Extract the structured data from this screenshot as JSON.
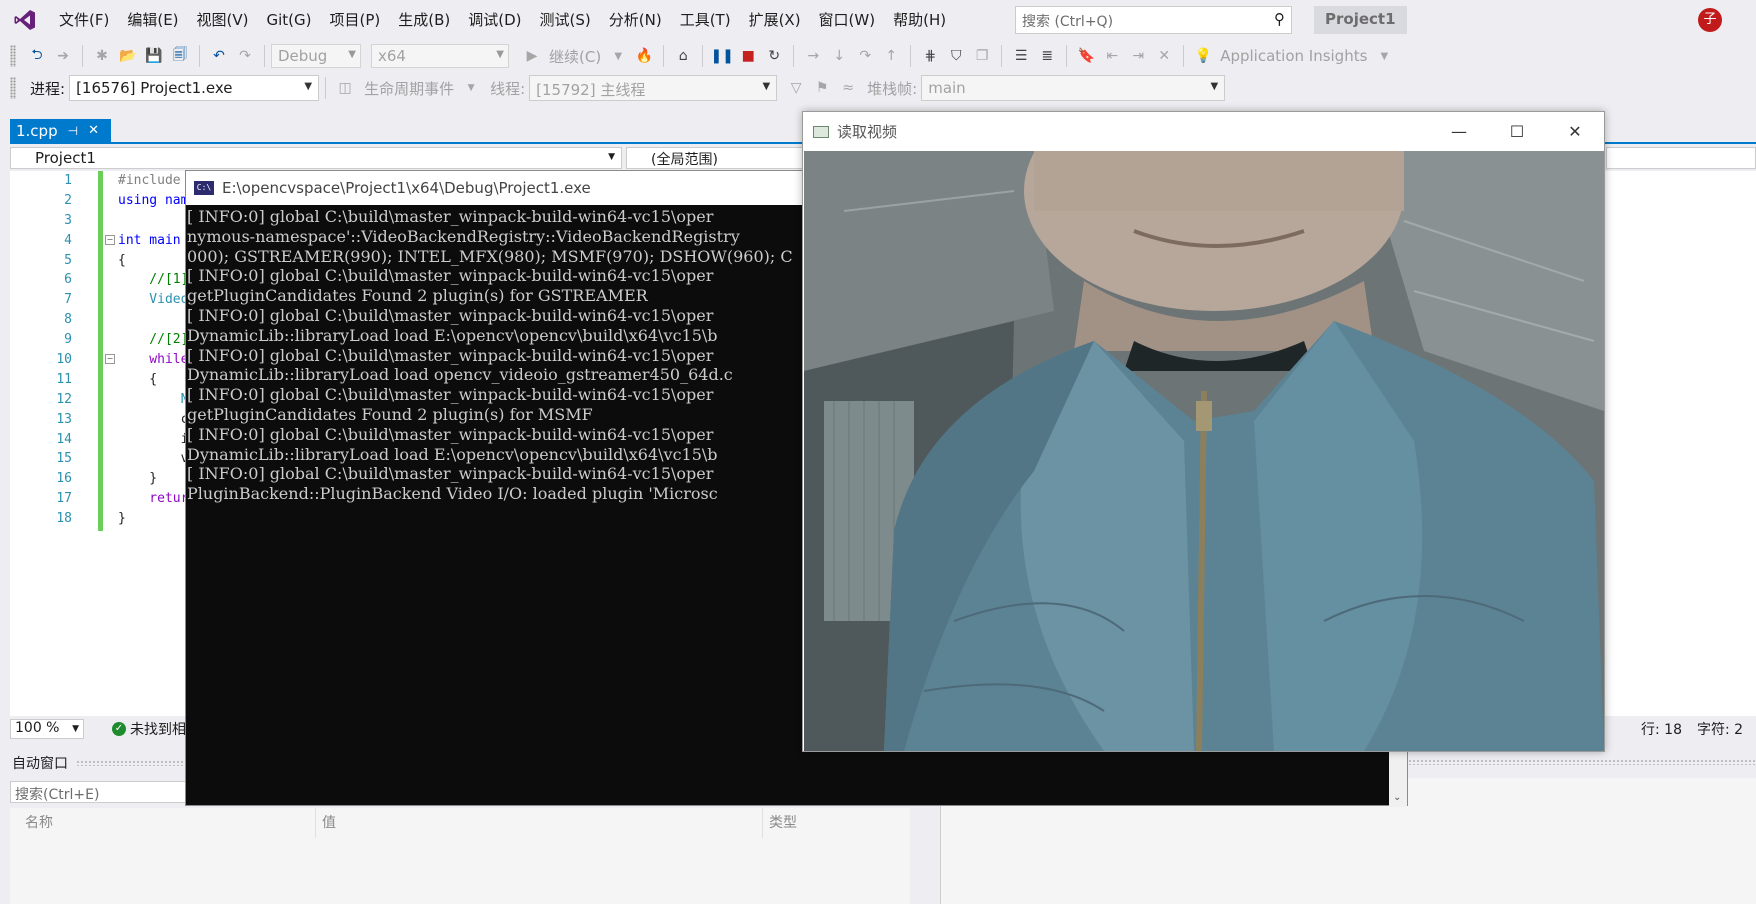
{
  "menubar": {
    "items": [
      "文件(F)",
      "编辑(E)",
      "视图(V)",
      "Git(G)",
      "项目(P)",
      "生成(B)",
      "调试(D)",
      "测试(S)",
      "分析(N)",
      "工具(T)",
      "扩展(X)",
      "窗口(W)",
      "帮助(H)"
    ],
    "search_placeholder": "搜索 (Ctrl+Q)",
    "project_badge": "Project1",
    "avatar_initial": "子"
  },
  "toolbar1": {
    "config": "Debug",
    "platform": "x64",
    "continue_label": "继续(C)",
    "app_insights": "Application Insights"
  },
  "toolbar2": {
    "process_label": "进程:",
    "process_value": "[16576] Project1.exe",
    "lifecycle_label": "生命周期事件",
    "thread_label": "线程:",
    "thread_value": "[15792] 主线程",
    "stackframe_label": "堆栈帧:",
    "stackframe_value": "main"
  },
  "editor": {
    "tab_label": "1.cpp",
    "nav_project": "Project1",
    "nav_scope": "(全局范围)",
    "line_numbers": [
      "1",
      "2",
      "3",
      "4",
      "5",
      "6",
      "7",
      "8",
      "9",
      "10",
      "11",
      "12",
      "13",
      "14",
      "15",
      "16",
      "17",
      "18"
    ],
    "code_lines": [
      "#include",
      "using nam",
      "",
      "int main",
      "{",
      "    //[1]",
      "    Video",
      "",
      "    //[2]",
      "    while",
      "    {",
      "        N",
      "        c",
      "        i",
      "        v",
      "    }",
      "    retur",
      "}"
    ],
    "zoom": "100 %",
    "issues": "未找到相",
    "row": "行: 18",
    "col": "字符: 2"
  },
  "autos": {
    "title": "自动窗口",
    "search_placeholder": "搜索(Ctrl+E)",
    "columns": [
      "名称",
      "值",
      "类型"
    ]
  },
  "console": {
    "title": "E:\\opencvspace\\Project1\\x64\\Debug\\Project1.exe",
    "lines": [
      "[ INFO:0] global C:\\build\\master_winpack-build-win64-vc15\\oper",
      "nymous-namespace'::VideoBackendRegistry::VideoBackendRegistry",
      "000); GSTREAMER(990); INTEL_MFX(980); MSMF(970); DSHOW(960); C",
      "[ INFO:0] global C:\\build\\master_winpack-build-win64-vc15\\oper",
      "getPluginCandidates Found 2 plugin(s) for GSTREAMER",
      "[ INFO:0] global C:\\build\\master_winpack-build-win64-vc15\\oper",
      "DynamicLib::libraryLoad load E:\\opencv\\opencv\\build\\x64\\vc15\\b",
      "[ INFO:0] global C:\\build\\master_winpack-build-win64-vc15\\oper",
      "DynamicLib::libraryLoad load opencv_videoio_gstreamer450_64d.c",
      "[ INFO:0] global C:\\build\\master_winpack-build-win64-vc15\\oper",
      "getPluginCandidates Found 2 plugin(s) for MSMF",
      "[ INFO:0] global C:\\build\\master_winpack-build-win64-vc15\\oper",
      "DynamicLib::libraryLoad load E:\\opencv\\opencv\\build\\x64\\vc15\\b",
      "[ INFO:0] global C:\\build\\master_winpack-build-win64-vc15\\oper",
      "PluginBackend::PluginBackend Video I/O: loaded plugin 'Microsc"
    ]
  },
  "video_window": {
    "title": "读取视频"
  },
  "colors": {
    "accent": "#007acc",
    "change_bar": "#6bcd5a",
    "console_bg": "#0c0c0c"
  }
}
